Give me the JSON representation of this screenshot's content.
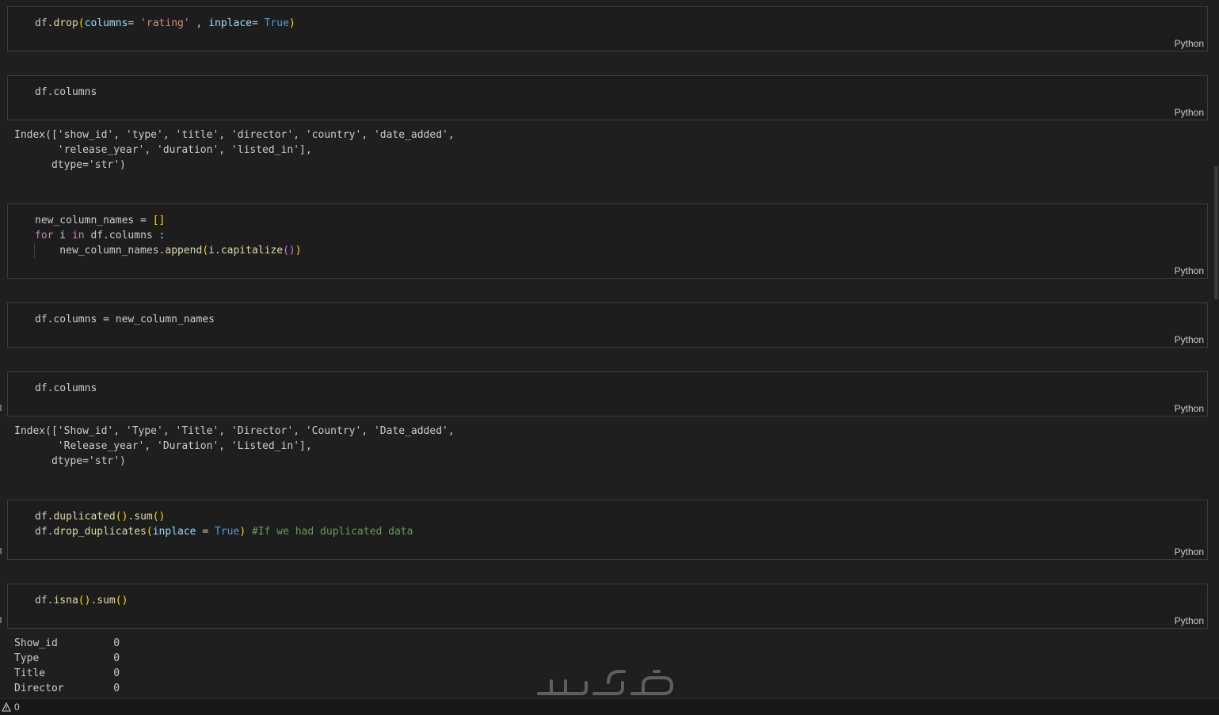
{
  "cells": [
    {
      "language": "Python",
      "code_lines": [
        [
          [
            "plain",
            "df."
          ],
          [
            "fn",
            "drop"
          ],
          [
            "br1",
            "("
          ],
          [
            "var",
            "columns"
          ],
          [
            "plain",
            "= "
          ],
          [
            "str",
            "'rating'"
          ],
          [
            "plain",
            " , "
          ],
          [
            "var",
            "inplace"
          ],
          [
            "plain",
            "= "
          ],
          [
            "bool",
            "True"
          ],
          [
            "br1",
            ")"
          ]
        ]
      ]
    },
    {
      "language": "Python",
      "code_lines": [
        [
          [
            "plain",
            "df.columns"
          ]
        ]
      ],
      "output": "Index(['show_id', 'type', 'title', 'director', 'country', 'date_added',\n       'release_year', 'duration', 'listed_in'],\n      dtype='str')"
    },
    {
      "language": "Python",
      "code_lines": [
        [
          [
            "plain",
            "new_column_names = "
          ],
          [
            "br1",
            "[]"
          ]
        ],
        [
          [
            "kw",
            "for"
          ],
          [
            "plain",
            " i "
          ],
          [
            "kw",
            "in"
          ],
          [
            "plain",
            " df.columns :"
          ]
        ],
        [
          [
            "plain",
            "    new_column_names."
          ],
          [
            "fn",
            "append"
          ],
          [
            "br1",
            "("
          ],
          [
            "plain",
            "i."
          ],
          [
            "fn",
            "capitalize"
          ],
          [
            "br2",
            "()"
          ],
          [
            "br1",
            ")"
          ]
        ]
      ]
    },
    {
      "language": "Python",
      "code_lines": [
        [
          [
            "plain",
            "df.columns = new_column_names"
          ]
        ]
      ]
    },
    {
      "language": "Python",
      "code_lines": [
        [
          [
            "plain",
            "df.columns"
          ]
        ]
      ],
      "output": "Index(['Show_id', 'Type', 'Title', 'Director', 'Country', 'Date_added',\n       'Release_year', 'Duration', 'Listed_in'],\n      dtype='str')"
    },
    {
      "language": "Python",
      "code_lines": [
        [
          [
            "plain",
            "df."
          ],
          [
            "fn",
            "duplicated"
          ],
          [
            "br1",
            "()"
          ],
          [
            "plain",
            "."
          ],
          [
            "fn",
            "sum"
          ],
          [
            "br1",
            "()"
          ]
        ],
        [
          [
            "plain",
            "df."
          ],
          [
            "fn",
            "drop_duplicates"
          ],
          [
            "br1",
            "("
          ],
          [
            "var",
            "inplace"
          ],
          [
            "plain",
            " = "
          ],
          [
            "bool",
            "True"
          ],
          [
            "br1",
            ")"
          ],
          [
            "plain",
            " "
          ],
          [
            "cmt",
            "#If we had duplicated data"
          ]
        ]
      ]
    },
    {
      "language": "Python",
      "code_lines": [
        [
          [
            "plain",
            "df."
          ],
          [
            "fn",
            "isna"
          ],
          [
            "br1",
            "()"
          ],
          [
            "plain",
            "."
          ],
          [
            "fn",
            "sum"
          ],
          [
            "br1",
            "()"
          ]
        ]
      ],
      "output": "Show_id         0\nType            0\nTitle           0\nDirector        0"
    }
  ],
  "statusbar": {
    "warning_count": "0",
    "warning_icon": "warning-icon"
  },
  "watermark": "خمسات"
}
